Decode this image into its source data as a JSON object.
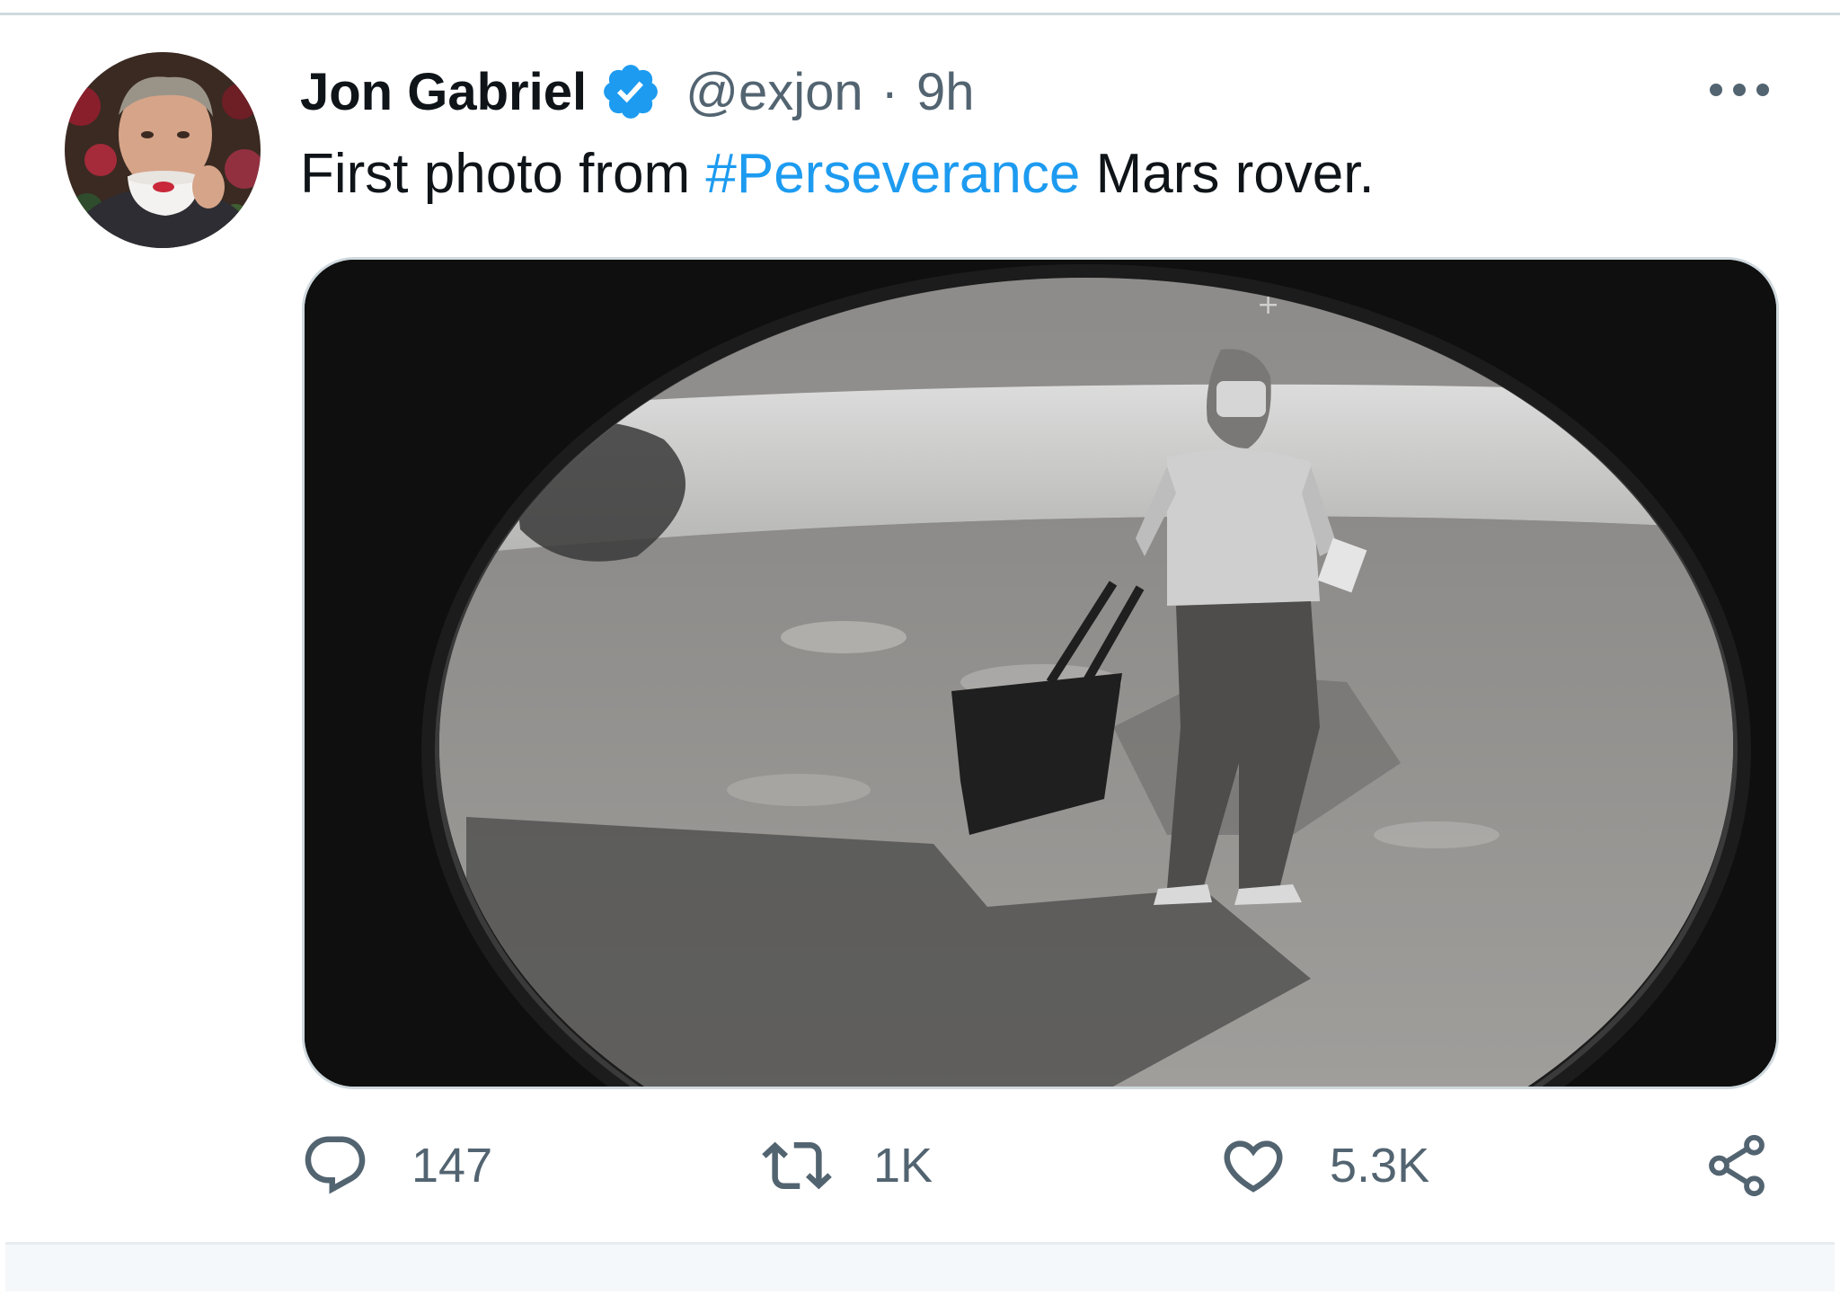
{
  "tweet": {
    "author_name": "Jon Gabriel",
    "handle": "@exjon",
    "separator": "·",
    "timestamp": "9h",
    "text_before": "First photo from ",
    "hashtag": "#Perseverance",
    "text_after": " Mars rover."
  },
  "actions": {
    "reply_count": "147",
    "retweet_count": "1K",
    "like_count": "5.3K"
  },
  "colors": {
    "accent": "#1d9bf0",
    "text_primary": "#0f1419",
    "text_secondary": "#536471"
  },
  "icons": [
    "verified-badge-icon",
    "more-icon",
    "reply-icon",
    "retweet-icon",
    "like-icon",
    "share-icon"
  ]
}
